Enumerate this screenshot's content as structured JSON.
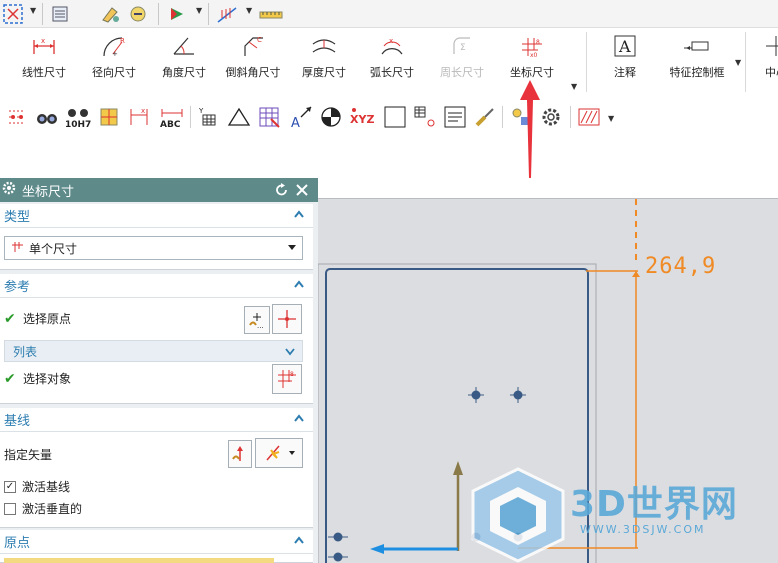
{
  "ribbon": {
    "items": [
      {
        "label": "线性尺寸",
        "icon": "linear-dimension-icon",
        "enabled": true
      },
      {
        "label": "径向尺寸",
        "icon": "radial-dimension-icon",
        "enabled": true
      },
      {
        "label": "角度尺寸",
        "icon": "angular-dimension-icon",
        "enabled": true
      },
      {
        "label": "倒斜角尺寸",
        "icon": "chamfer-dimension-icon",
        "enabled": true
      },
      {
        "label": "厚度尺寸",
        "icon": "thickness-dimension-icon",
        "enabled": true
      },
      {
        "label": "弧长尺寸",
        "icon": "arc-length-dimension-icon",
        "enabled": true
      },
      {
        "label": "周长尺寸",
        "icon": "perimeter-dimension-icon",
        "enabled": false
      },
      {
        "label": "坐标尺寸",
        "icon": "ordinate-dimension-icon",
        "enabled": true
      },
      {
        "label": "注释",
        "icon": "note-icon",
        "enabled": true
      },
      {
        "label": "特征控制框",
        "icon": "feature-control-frame-icon",
        "enabled": true
      },
      {
        "label": "中心",
        "icon": "center-mark-icon",
        "enabled": true
      }
    ]
  },
  "iconrow": {
    "tolerance_label": "10H7",
    "abc_label": "ABC",
    "xyz_label": "XYZ"
  },
  "dialog": {
    "title": "坐标尺寸",
    "type_section": {
      "header": "类型",
      "selected": "单个尺寸"
    },
    "reference_section": {
      "header": "参考",
      "select_origin": "选择原点",
      "list_label": "列表",
      "select_object": "选择对象"
    },
    "baseline_section": {
      "header": "基线",
      "specify_vector": "指定矢量",
      "activate_baseline": "激活基线",
      "activate_baseline_checked": true,
      "activate_perpendicular": "激活垂直的",
      "activate_perpendicular_checked": false
    },
    "origin_section": {
      "header": "原点"
    }
  },
  "canvas": {
    "dimension_value": "264,9",
    "dimension_color": "#f08a24",
    "arrow_color": "#e8323c"
  },
  "watermark": {
    "brand": "3D世界网",
    "url": "WWW.3DSJW.COM"
  }
}
